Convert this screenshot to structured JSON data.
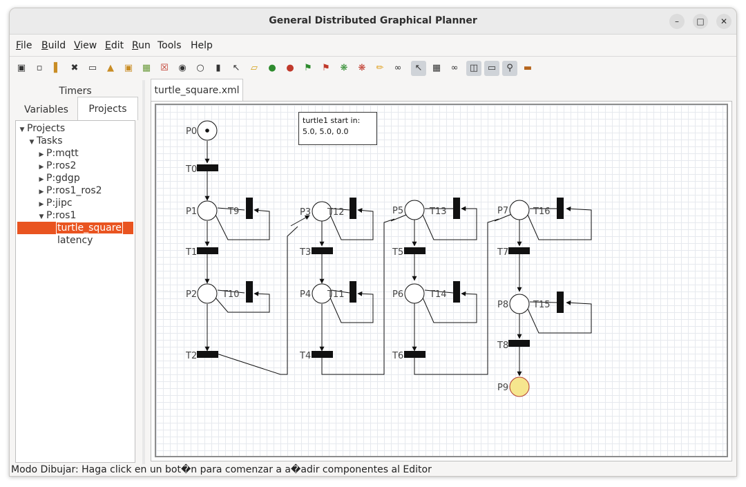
{
  "window": {
    "title": "General Distributed Graphical Planner",
    "controls": [
      "minimize-icon",
      "maximize-icon",
      "close-icon"
    ]
  },
  "menu": {
    "file": "File",
    "build": "Build",
    "view": "View",
    "edit": "Edit",
    "run": "Run",
    "tools": "Tools",
    "help": "Help"
  },
  "toolbar": [
    "camera-icon",
    "new-file-icon",
    "books-icon",
    "cross-icon",
    "page-icon",
    "open-folder-icon",
    "folder-up-icon",
    "folder-add-icon",
    "delete-doc-icon",
    "binoculars-icon",
    "place-circle-icon",
    "transition-bar-icon",
    "arrow-icon",
    "eraser-icon",
    "add-token-icon",
    "remove-token-icon",
    "add-flag-icon",
    "remove-flag-icon",
    "add-bug-icon",
    "remove-bug-icon",
    "pencil-icon",
    "link-icon",
    "select-pointer-icon",
    "grid-icon",
    "glasses-icon",
    "copy-icon",
    "panel-icon",
    "zoom-icon",
    "book-icon"
  ],
  "left_panel": {
    "timers_label": "Timers",
    "tabs": {
      "variables": "Variables",
      "projects": "Projects"
    },
    "tree": {
      "root": "Projects",
      "tasks": "Tasks",
      "items": [
        "P:mqtt",
        "P:ros2",
        "P:gdgp",
        "P:ros1_ros2",
        "P:jipc",
        "P:ros1"
      ],
      "children": [
        "turtle_square",
        "latency"
      ]
    }
  },
  "editor": {
    "tab_title": "turtle_square.xml",
    "annotation": {
      "line1": "turtle1 start in:",
      "line2": "5.0, 5.0, 0.0"
    }
  },
  "petri_net": {
    "places": [
      "P0",
      "P1",
      "P2",
      "P3",
      "P4",
      "P5",
      "P6",
      "P7",
      "P8",
      "P9"
    ],
    "transitions": [
      "T0",
      "T1",
      "T2",
      "T3",
      "T4",
      "T5",
      "T6",
      "T7",
      "T8",
      "T9",
      "T10",
      "T11",
      "T12",
      "T13",
      "T14",
      "T15",
      "T16"
    ],
    "final_place_color": "#f6e68e",
    "token_place": "P0"
  },
  "status": {
    "text": "Modo Dibujar: Haga click en un bot�n para comenzar a a�adir componentes al Editor"
  },
  "colors": {
    "selection": "#e95420",
    "final_place": "#f6e68e"
  }
}
